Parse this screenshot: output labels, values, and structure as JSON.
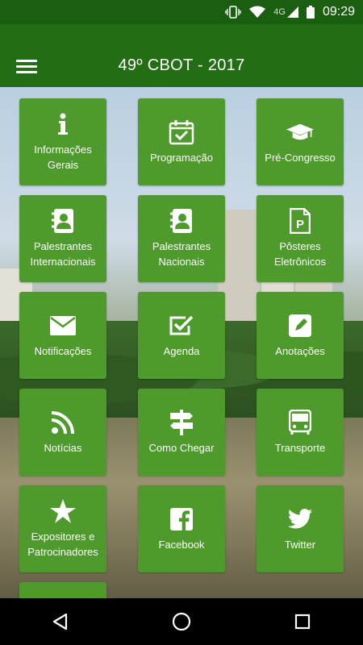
{
  "status_bar": {
    "network": "4G",
    "time": "09:29",
    "icons": [
      "vibrate-icon",
      "wifi-icon",
      "signal-icon",
      "battery-icon"
    ]
  },
  "app_bar": {
    "title": "49º CBOT - 2017",
    "menu_icon": "hamburger-menu-icon"
  },
  "colors": {
    "status_bar": "#1a5e10",
    "app_bar": "#236d14",
    "tile": "#4e9a2c",
    "text": "#ffffff"
  },
  "tiles": [
    {
      "label": "Informações Gerais",
      "icon": "info-icon"
    },
    {
      "label": "Programação",
      "icon": "calendar-check-icon"
    },
    {
      "label": "Pré-Congresso",
      "icon": "graduation-cap-icon"
    },
    {
      "label": "Palestrantes Internacionais",
      "icon": "contact-book-icon"
    },
    {
      "label": "Palestrantes Nacionais",
      "icon": "contact-book-icon"
    },
    {
      "label": "Pôsteres Eletrônicos",
      "icon": "poster-file-icon"
    },
    {
      "label": "Notificações",
      "icon": "envelope-icon"
    },
    {
      "label": "Agenda",
      "icon": "checkbox-icon"
    },
    {
      "label": "Anotações",
      "icon": "pencil-square-icon"
    },
    {
      "label": "Notícias",
      "icon": "rss-icon"
    },
    {
      "label": "Como Chegar",
      "icon": "signpost-icon"
    },
    {
      "label": "Transporte",
      "icon": "bus-icon"
    },
    {
      "label": "Expositores e Patrocinadores",
      "icon": "star-icon"
    },
    {
      "label": "Facebook",
      "icon": "facebook-icon"
    },
    {
      "label": "Twitter",
      "icon": "twitter-icon"
    }
  ],
  "nav_bar": {
    "buttons": [
      "back-icon",
      "home-icon",
      "recents-icon"
    ]
  }
}
